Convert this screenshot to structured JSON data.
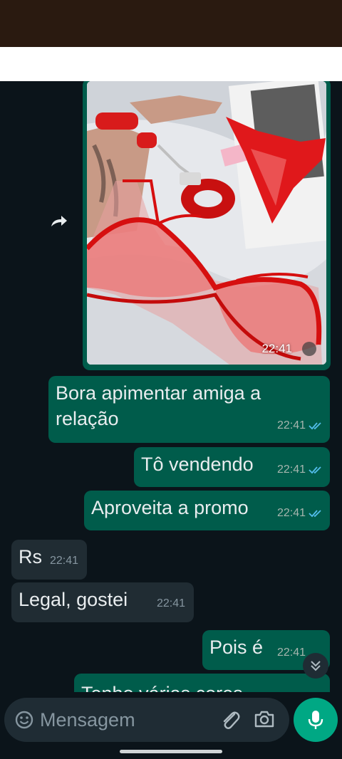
{
  "chat": {
    "image_message": {
      "time": "22:41"
    },
    "messages": [
      {
        "direction": "out",
        "lines": [
          "Bora apimentar amiga a",
          "relação"
        ],
        "time": "22:41",
        "read": true
      },
      {
        "direction": "out",
        "text": "Tô vendendo",
        "time": "22:41",
        "read": true
      },
      {
        "direction": "out",
        "text": "Aproveita a promo",
        "time": "22:41",
        "read": true
      },
      {
        "direction": "in",
        "text": "Rs",
        "time": "22:41"
      },
      {
        "direction": "in",
        "text": "Legal, gostei",
        "time": "22:41"
      },
      {
        "direction": "out",
        "text": "Pois é",
        "time": "22:41"
      },
      {
        "direction": "out",
        "text": "Tenho várias cores",
        "partial": true
      }
    ]
  },
  "composer": {
    "placeholder": "Mensagem"
  },
  "icons": {
    "forward": "forward-icon",
    "scroll_down": "chevron-double-down-icon",
    "emoji": "emoji-icon",
    "attach": "paperclip-icon",
    "camera": "camera-icon",
    "mic": "mic-icon"
  },
  "colors": {
    "background": "#0b141a",
    "outgoing_bubble": "#005c4b",
    "incoming_bubble": "#202c33",
    "read_ticks": "#53bdeb",
    "accent": "#00a884"
  }
}
